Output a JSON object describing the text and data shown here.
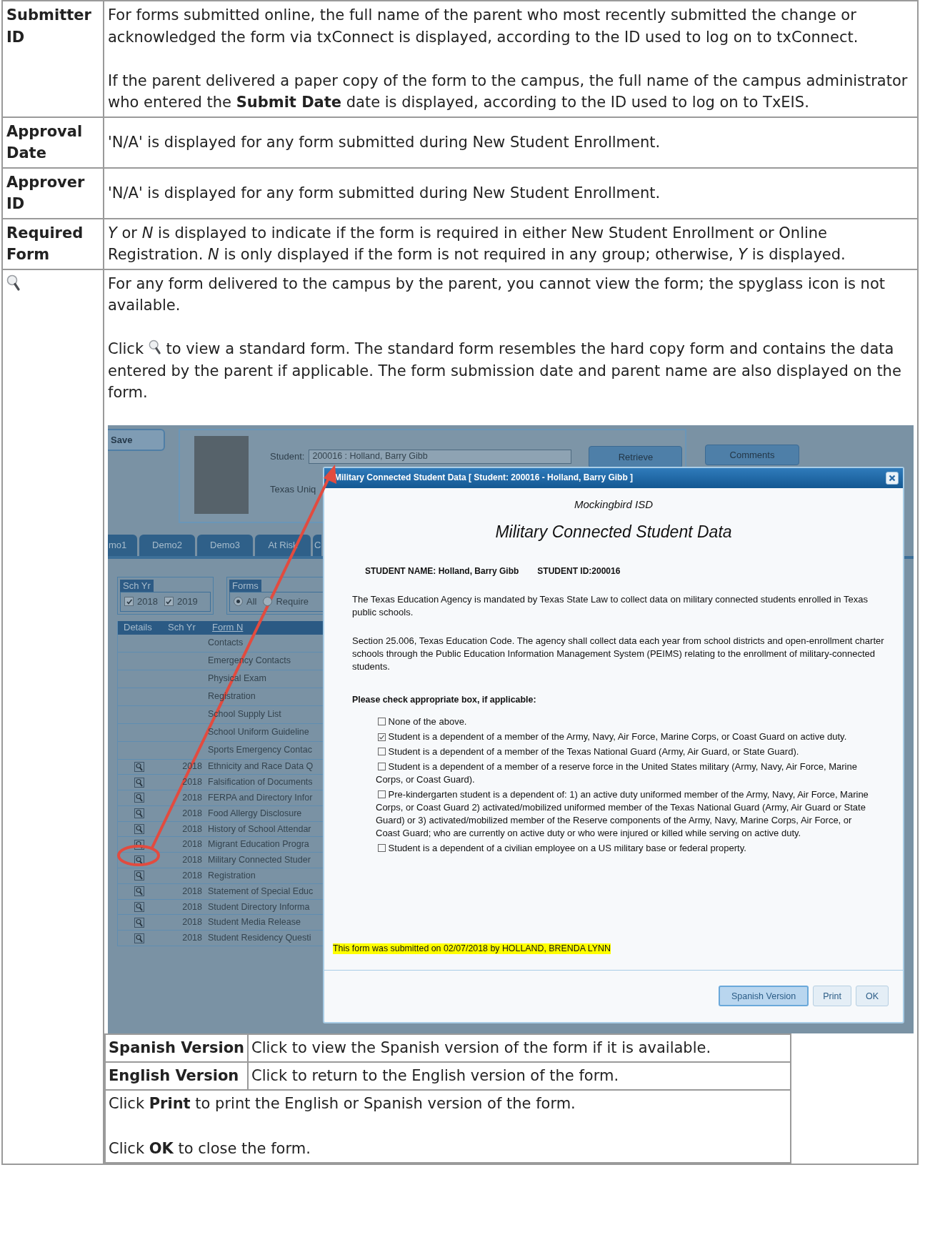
{
  "doc_rows": [
    {
      "kind": "text",
      "field": "Submitter ID",
      "paragraphs": [
        {
          "kind": "plain",
          "text": "For forms submitted online, the full name of the parent who most recently submitted the change or acknowledged the form via txConnect is displayed, according to the ID used to log on to txConnect."
        },
        {
          "kind": "plain",
          "text": "If the parent delivered a paper copy of the form to the campus, the full name of the campus administrator who entered the **Submit Date** date is displayed, according to the ID used to log on to TxEIS."
        }
      ]
    },
    {
      "kind": "text",
      "field": "Approval Date",
      "paragraphs": [
        {
          "kind": "plain",
          "text": "'N/A' is displayed for any form submitted during New Student Enrollment."
        }
      ]
    },
    {
      "kind": "text",
      "field": "Approver ID",
      "paragraphs": [
        {
          "kind": "plain",
          "text": "'N/A' is displayed for any form submitted during New Student Enrollment."
        }
      ]
    },
    {
      "kind": "text",
      "field": "Required Form",
      "paragraphs": [
        {
          "kind": "plain",
          "text": "*Y* or *N* is displayed to indicate if the form is required in either New Student Enrollment or Online Registration. *N* is only displayed if the form is not required in any group; otherwise, *Y* is displayed."
        }
      ]
    },
    {
      "kind": "icon",
      "paragraphs": [
        {
          "kind": "plain",
          "text": "For any form delivered to the campus by the parent, you cannot view the form; the spyglass icon is not available."
        },
        {
          "kind": "icon_inline",
          "before": "Click",
          "after": "to view a standard form. The standard form resembles the hard copy form and contains the data entered by the parent if applicable. The form submission date and parent name are also displayed on the form."
        }
      ],
      "screenshot": {
        "app": {
          "save_button": "Save",
          "student_label": "Student:",
          "student_value": "200016 : Holland, Barry Gibb",
          "retrieve_button": "Retrieve",
          "comments_button": "Comments",
          "texas_label": "Texas Uniq",
          "tabs": [
            "mo1",
            "Demo2",
            "Demo3",
            "At Risk",
            "C"
          ],
          "sch_yr": {
            "title": "Sch Yr",
            "options": [
              {
                "label": "2018",
                "checked": true
              },
              {
                "label": "2019",
                "checked": true
              }
            ]
          },
          "forms_filter": {
            "title": "Forms",
            "options": [
              {
                "label": "All",
                "selected": true
              },
              {
                "label": "Require",
                "selected": false
              }
            ]
          },
          "columns": [
            "Details",
            "Sch Yr",
            "Form N"
          ],
          "rows": [
            {
              "details_icon": false,
              "circled": false,
              "sch_yr": "",
              "form": "Contacts"
            },
            {
              "details_icon": false,
              "circled": false,
              "sch_yr": "",
              "form": "Emergency Contacts"
            },
            {
              "details_icon": false,
              "circled": false,
              "sch_yr": "",
              "form": "Physical Exam"
            },
            {
              "details_icon": false,
              "circled": false,
              "sch_yr": "",
              "form": "Registration"
            },
            {
              "details_icon": false,
              "circled": false,
              "sch_yr": "",
              "form": "School Supply List"
            },
            {
              "details_icon": false,
              "circled": false,
              "sch_yr": "",
              "form": "School Uniform Guideline"
            },
            {
              "details_icon": false,
              "circled": false,
              "sch_yr": "",
              "form": "Sports Emergency Contac"
            },
            {
              "details_icon": true,
              "circled": false,
              "sch_yr": "2018",
              "form": "Ethnicity and Race Data Q"
            },
            {
              "details_icon": true,
              "circled": false,
              "sch_yr": "2018",
              "form": "Falsification of Documents"
            },
            {
              "details_icon": true,
              "circled": false,
              "sch_yr": "2018",
              "form": "FERPA and Directory Infor"
            },
            {
              "details_icon": true,
              "circled": false,
              "sch_yr": "2018",
              "form": "Food Allergy Disclosure"
            },
            {
              "details_icon": true,
              "circled": false,
              "sch_yr": "2018",
              "form": "History of School Attendar"
            },
            {
              "details_icon": true,
              "circled": false,
              "sch_yr": "2018",
              "form": "Migrant Education Progra"
            },
            {
              "details_icon": true,
              "circled": true,
              "sch_yr": "2018",
              "form": "Military Connected Studer"
            },
            {
              "details_icon": true,
              "circled": false,
              "sch_yr": "2018",
              "form": "Registration"
            },
            {
              "details_icon": true,
              "circled": false,
              "sch_yr": "2018",
              "form": "Statement of Special Educ"
            },
            {
              "details_icon": true,
              "circled": false,
              "sch_yr": "2018",
              "form": "Student Directory Informa"
            },
            {
              "details_icon": true,
              "circled": false,
              "sch_yr": "2018",
              "form": "Student Media Release"
            },
            {
              "details_icon": true,
              "circled": false,
              "sch_yr": "2018",
              "form": "Student Residency Questi"
            }
          ]
        },
        "dialog": {
          "title": "Military Connected Student Data [ Student: 200016 - Holland, Barry Gibb ]",
          "district": "Mockingbird ISD",
          "heading": "Military Connected Student Data",
          "student_name": "STUDENT NAME:  Holland, Barry Gibb",
          "student_id": "STUDENT ID:200016",
          "paragraphs": [
            "The Texas Education Agency is mandated by Texas State Law to collect data on military connected students enrolled in Texas public schools.",
            "Section 25.006, Texas Education Code. The agency shall collect data each year from school districts and open-enrollment charter schools through the Public Education Information Management System (PEIMS) relating to the enrollment of military-connected students."
          ],
          "prompt": "Please check appropriate box, if applicable:",
          "options": [
            {
              "label": "None of the above.",
              "checked": false
            },
            {
              "label": "Student is a dependent of a member of the Army, Navy, Air Force, Marine Corps, or Coast Guard on active duty.",
              "checked": true
            },
            {
              "label": "Student is a dependent of a member of the Texas National Guard (Army, Air Guard, or State Guard).",
              "checked": false
            },
            {
              "label": "Student is a dependent of a member of a reserve force in the United States military (Army, Navy, Air Force, Marine Corps, or Coast Guard).",
              "checked": false
            },
            {
              "label": "Pre-kindergarten student is a dependent of: 1) an active duty uniformed member of the Army, Navy, Air Force, Marine Corps, or Coast Guard 2) activated/mobilized uniformed member of the Texas National Guard (Army, Air Guard or State Guard) or 3) activated/mobilized member of the Reserve components of the Army, Navy, Marine Corps, Air Force, or Coast Guard; who are currently on active duty or who were injured or killed while serving on active duty.",
              "checked": false
            },
            {
              "label": "Student is a dependent of a civilian employee on a US military base or federal property.",
              "checked": false
            }
          ],
          "submitted_note": "This form was submitted on 02/07/2018 by HOLLAND, BRENDA LYNN",
          "buttons": [
            {
              "label": "Spanish Version",
              "focused": true
            },
            {
              "label": "Print",
              "focused": false
            },
            {
              "label": "OK",
              "focused": false
            }
          ]
        }
      },
      "buttons_table": {
        "rows": [
          {
            "term": "Spanish Version",
            "description": "Click to view the Spanish version of the form if it is available."
          },
          {
            "term": "English Version",
            "description": "Click to return to the English version of the form."
          }
        ],
        "notes": [
          "Click **Print** to print the English or Spanish version of the form.",
          "Click **OK** to close the form."
        ]
      }
    }
  ]
}
